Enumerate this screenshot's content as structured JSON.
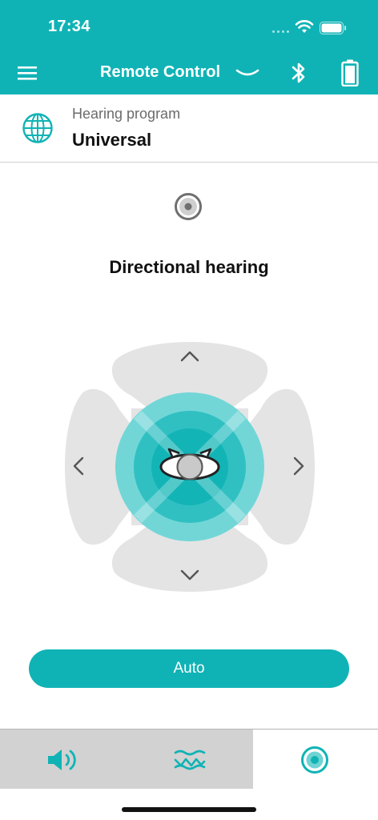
{
  "status_bar": {
    "time": "17:34",
    "wifi_icon": "wifi-icon",
    "battery_icon": "battery-icon"
  },
  "app_bar": {
    "title": "Remote Control",
    "menu_icon": "hamburger-menu-icon",
    "chevron_icon": "chevron-down-icon",
    "bluetooth_icon": "bluetooth-icon",
    "battery_icon": "battery-full-icon"
  },
  "program": {
    "label": "Hearing program",
    "value": "Universal",
    "icon": "globe-icon"
  },
  "directional": {
    "title": "Directional hearing",
    "indicator_icon": "focus-dot-icon",
    "arrows": [
      "chevron-up-icon",
      "chevron-left-icon",
      "chevron-right-icon",
      "chevron-down-icon"
    ],
    "center_icon": "head-with-ears-icon"
  },
  "auto_button": {
    "label": "Auto"
  },
  "tabs": [
    {
      "icon": "speaker-volume-icon",
      "active": false
    },
    {
      "icon": "waves-icon",
      "active": false
    },
    {
      "icon": "directional-focus-icon",
      "active": true
    }
  ],
  "colors": {
    "accent": "#10b3b5",
    "pad": "#e4e4e4",
    "tab_inactive": "#d2d2d2"
  }
}
